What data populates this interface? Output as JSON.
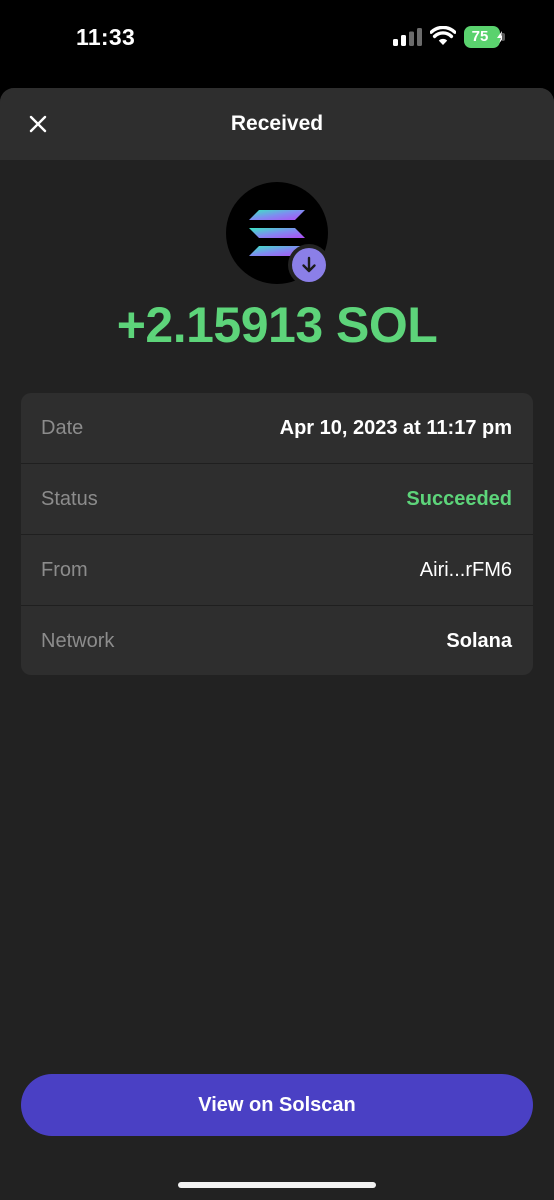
{
  "status_bar": {
    "time": "11:33",
    "battery_level": "75",
    "icons": [
      "cellular-signal-icon",
      "wifi-icon",
      "battery-charging-icon"
    ]
  },
  "sheet": {
    "title": "Received",
    "close_icon": "close-icon"
  },
  "token": {
    "icon": "solana-logo-icon",
    "badge_icon": "arrow-down-icon",
    "amount": "+2.15913 SOL"
  },
  "details": [
    {
      "label": "Date",
      "value": "Apr 10, 2023 at 11:17 pm",
      "style": "bold"
    },
    {
      "label": "Status",
      "value": "Succeeded",
      "style": "success"
    },
    {
      "label": "From",
      "value": "Airi...rFM6",
      "style": "regular"
    },
    {
      "label": "Network",
      "value": "Solana",
      "style": "bold"
    }
  ],
  "action": {
    "view_solscan_label": "View on Solscan"
  },
  "colors": {
    "accent_button": "#4a40c4",
    "success_green": "#5dd47a",
    "sheet_background": "#222222",
    "card_background": "#2e2e2e",
    "badge_purple": "#8b7fe8"
  }
}
